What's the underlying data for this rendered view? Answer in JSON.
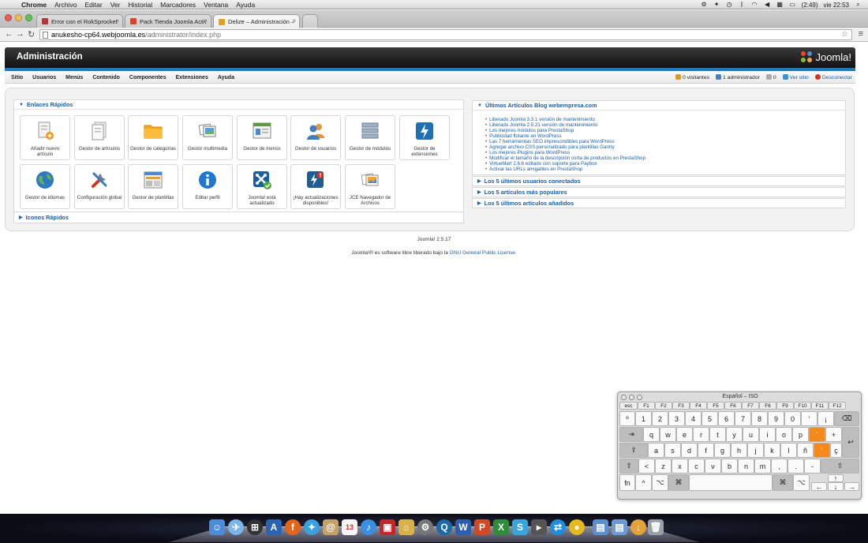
{
  "menubar": {
    "app": "Chrome",
    "items": [
      "Archivo",
      "Editar",
      "Ver",
      "Historial",
      "Marcadores",
      "Ventana",
      "Ayuda"
    ],
    "battery": "(2:49)",
    "clock": "vie 22:53"
  },
  "tabs": [
    {
      "title": "Error con el RokSprocket",
      "color": "#b4373d"
    },
    {
      "title": "Pack Tienda Joomla Activa",
      "color": "#d8452c"
    },
    {
      "title": "Delize – Administración –",
      "color": "#e0a21a"
    }
  ],
  "address": {
    "host": "anukesho-cp64.webjoomla.es",
    "path": "/administrator/index.php"
  },
  "admin": {
    "title": "Administración",
    "logo": "Joomla!",
    "nav": [
      "Sitio",
      "Usuarios",
      "Menús",
      "Contenido",
      "Componentes",
      "Extensiones",
      "Ayuda"
    ],
    "status": {
      "visitors": "0 visitantes",
      "admins": "1 administrador",
      "messages": "0",
      "view_site": "Ver sitio",
      "logout": "Desconectar"
    }
  },
  "quicklinks": {
    "title": "Enlaces Rápidos",
    "items": [
      {
        "label": "Añadir nuevo artículo",
        "icon": "add-article-icon"
      },
      {
        "label": "Gestor de artículos",
        "icon": "article-manager-icon"
      },
      {
        "label": "Gestor de categorías",
        "icon": "category-manager-icon"
      },
      {
        "label": "Gestor multimedia",
        "icon": "media-manager-icon"
      },
      {
        "label": "Gestor de menús",
        "icon": "menu-manager-icon"
      },
      {
        "label": "Gestor de usuarios",
        "icon": "user-manager-icon"
      },
      {
        "label": "Gestor de módulos",
        "icon": "module-manager-icon"
      },
      {
        "label": "Gestor de extensiones",
        "icon": "extension-manager-icon"
      },
      {
        "label": "Gestor de idiomas",
        "icon": "language-manager-icon"
      },
      {
        "label": "Configuración global",
        "icon": "global-config-icon"
      },
      {
        "label": "Gestor de plantillas",
        "icon": "template-manager-icon"
      },
      {
        "label": "Editar perfil",
        "icon": "edit-profile-icon"
      },
      {
        "label": "Joomla! está actualizado",
        "icon": "joomla-updated-icon"
      },
      {
        "label": "¡Hay actualizaciones disponibles!",
        "icon": "updates-available-icon"
      },
      {
        "label": "JCE Navegador de Archivos",
        "icon": "jce-browser-icon"
      }
    ]
  },
  "quickicons": {
    "title": "Iconos Rápidos"
  },
  "blog": {
    "title": "Últimos Artículos Blog webempresa.com",
    "items": [
      "Liberado Joomla 3.3.1 versión de mantenimiento",
      "Liberado Joomla 2.5.21 versión de mantenimiento",
      "Los mejores módulos para PrestaShop",
      "Publicidad flotante en WordPress",
      "Las 7 herramientas SEO imprescindibles para WordPress",
      "Agregar archivo CSS personalizado para plantillas Gantry",
      "Los mejores Plugins para WordPress",
      "Modificar el tamaño de la descripción corta de productos en PrestaShop",
      "VirtueMart 2.6.6 editado con soporte para Paybox",
      "Activar las URLs amigables en PrestaShop"
    ]
  },
  "sections": [
    "Los 5 últimos usuarios conectados",
    "Los 5 artículos más populares",
    "Los 5 últimos artículos añadidos"
  ],
  "footer": {
    "version": "Joomla! 2.5.17",
    "license_prefix": "Joomla!® es software libre liberado bajo la",
    "license_link": "GNU General Public License."
  },
  "keyboard": {
    "title": "Español – ISO",
    "fn_row": [
      "esc",
      "F1",
      "F2",
      "F3",
      "F4",
      "F5",
      "F6",
      "F7",
      "F8",
      "F9",
      "F10",
      "F11",
      "F12"
    ],
    "row1": [
      "º",
      "1",
      "2",
      "3",
      "4",
      "5",
      "6",
      "7",
      "8",
      "9",
      "0",
      "'",
      "¡",
      "⌫"
    ],
    "row2": [
      "⇥",
      "q",
      "w",
      "e",
      "r",
      "t",
      "y",
      "u",
      "i",
      "o",
      "p",
      "`",
      "+",
      "↩"
    ],
    "row3": [
      "⇪",
      "a",
      "s",
      "d",
      "f",
      "g",
      "h",
      "j",
      "k",
      "l",
      "ñ",
      "´",
      "ç"
    ],
    "row4": [
      "⇧",
      "<",
      "z",
      "x",
      "c",
      "v",
      "b",
      "n",
      "m",
      ",",
      ".",
      "-",
      "⇧"
    ],
    "row5": [
      "fn",
      "^",
      "⌥",
      "⌘",
      "⌘",
      "⌥"
    ]
  }
}
